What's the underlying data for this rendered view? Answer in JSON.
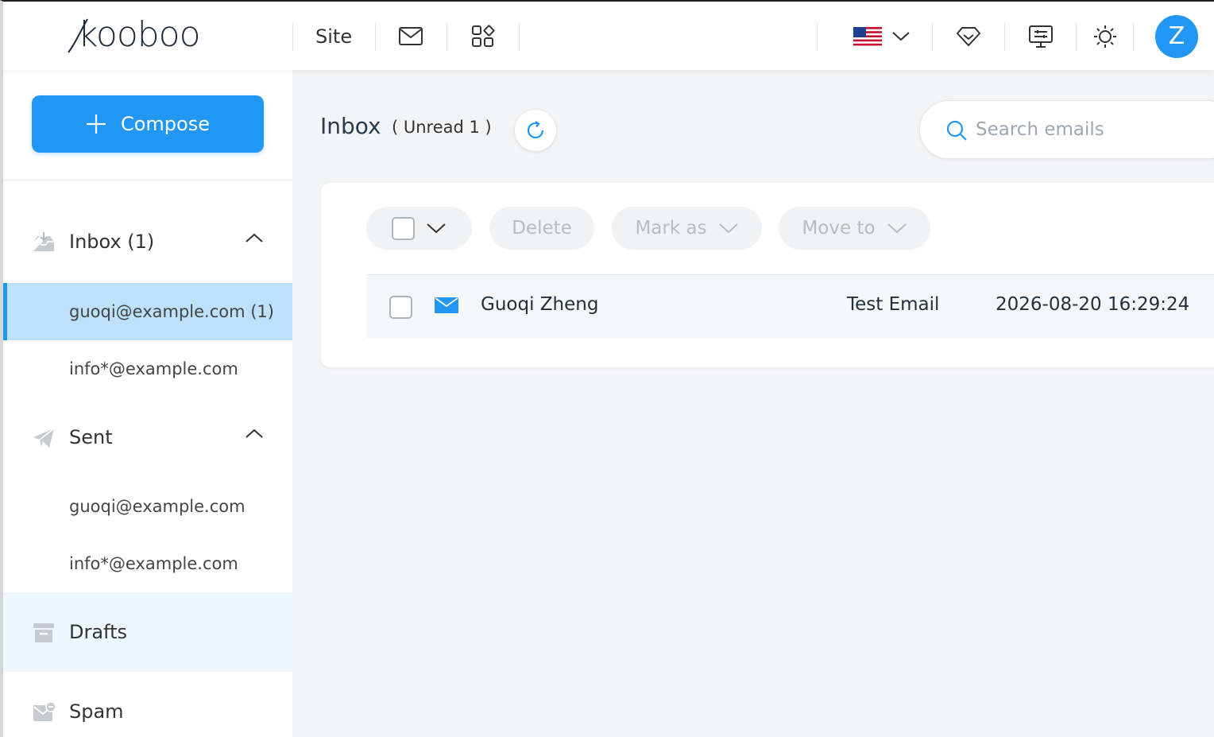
{
  "header": {
    "logo": "kooboo",
    "site_label": "Site",
    "icons": [
      "mail-icon",
      "apps-icon",
      "flag-us-icon",
      "chevron-down-icon",
      "diamond-icon",
      "monitor-icon",
      "sun-icon"
    ],
    "avatar_initial": "Z"
  },
  "sidebar": {
    "compose_label": "Compose",
    "inbox": {
      "label": "Inbox (1)",
      "accounts": [
        {
          "label": "guoqi@example.com (1)",
          "active": true
        },
        {
          "label": "info*@example.com",
          "active": false
        }
      ]
    },
    "sent": {
      "label": "Sent",
      "accounts": [
        {
          "label": "guoqi@example.com"
        },
        {
          "label": "info*@example.com"
        }
      ]
    },
    "drafts_label": "Drafts",
    "spam_label": "Spam"
  },
  "main": {
    "title": "Inbox",
    "unread": "( Unread 1 )",
    "search": {
      "placeholder": "Search emails"
    },
    "toolbar": {
      "delete_label": "Delete",
      "mark_as_label": "Mark as",
      "move_to_label": "Move to"
    },
    "emails": [
      {
        "from": "Guoqi Zheng",
        "subject": "Test Email",
        "date": "2026-08-20 16:29:24"
      }
    ]
  },
  "colors": {
    "accent": "#2196f3",
    "active_bg": "#bde0fb",
    "hover_bg": "#eef6ff",
    "page_bg": "#f3f4f5"
  }
}
